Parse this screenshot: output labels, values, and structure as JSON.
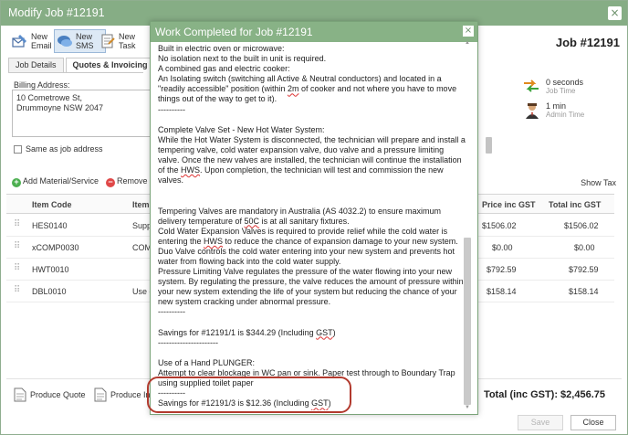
{
  "window": {
    "title": "Modify Job #12191",
    "job_number": "Job #12191"
  },
  "toolbar": {
    "email": "New Email",
    "sms": "New SMS",
    "task": "New Task"
  },
  "tabs": [
    {
      "label": "Job Details"
    },
    {
      "label": "Quotes & Invoicing"
    }
  ],
  "billing": {
    "label": "Billing Address:",
    "line1": "10 Cometrowe St,",
    "line2": "Drummoyne NSW 2047",
    "same_as_job": "Same as job address"
  },
  "time_info": {
    "job_time_value": "0 seconds",
    "job_time_label": "Job Time",
    "admin_time_value": "1 min",
    "admin_time_label": "Admin Time"
  },
  "materials": {
    "add": "Add Material/Service",
    "remove": "Remove Ma",
    "show_tax": "Show Tax"
  },
  "table": {
    "headers": {
      "code": "Item Code",
      "item": "Item",
      "price": "Price inc GST",
      "total": "Total inc GST"
    },
    "rows": [
      {
        "code": "HES0140",
        "item": "Supp",
        "price": "$1506.02",
        "total": "$1506.02"
      },
      {
        "code": "xCOMP0030",
        "item": "COM",
        "price": "$0.00",
        "total": "$0.00"
      },
      {
        "code": "HWT0010",
        "item": "",
        "price": "$792.59",
        "total": "$792.59"
      },
      {
        "code": "DBL0010",
        "item": "Use c",
        "price": "$158.14",
        "total": "$158.14"
      }
    ]
  },
  "footer": {
    "produce_quote": "Produce Quote",
    "produce_invoice": "Produce In",
    "total": "Total (inc GST): $2,456.75",
    "save": "Save",
    "close": "Close"
  },
  "modal": {
    "title": "Work Completed for Job #12191",
    "lines": [
      "Built in electric oven or microwave:",
      "No isolation next to the built in unit is required.",
      "A combined gas and electric cooker:",
      "An Isolating switch (switching all Active & Neutral conductors) and located in a \"readily accessible\" position (within ",
      "2m",
      " of cooker and not where you have to move things out of the way to get to it).",
      "----------",
      "",
      "Complete Valve Set - New Hot Water System:",
      "While the Hot Water System is disconnected, the technician will prepare and install a tempering valve, cold water expansion valve, duo valve and a pressure limiting valve. Once the new valves are installed, the technician will continue the installation of the ",
      "HWS",
      ". Upon completion, the technician will test and commission the new valves.",
      "",
      "",
      "Tempering Valves are mandatory in Australia (AS 4032.2) to ensure maximum delivery temperature of ",
      "50C",
      " is at all sanitary fixtures.",
      "Cold Water Expansion Valves is required to provide relief while the cold water is entering the ",
      "HWS",
      " to reduce the chance of expansion damage to your new system.",
      "Duo Valve controls the cold water entering into your new system and prevents hot water from flowing back into the cold water supply.",
      "Pressure Limiting Valve regulates the pressure of the water flowing into your new system. By regulating the pressure, the valve reduces the amount of pressure within your new system extending the life of your system but reducing the chance of your new system cracking under abnormal pressure.",
      "----------",
      "",
      "Savings for #12191/1 is $344.29 (Including ",
      "GST",
      ")",
      "----------------------",
      "",
      "Use of a Hand PLUNGER:",
      "Attempt to clear blockage in WC pan or sink. Paper test through to Boundary Trap using supplied toilet paper",
      "----------",
      "Savings for #12191/3 is $12.36 (Including ",
      "GST",
      ")",
      "----------------------"
    ]
  }
}
